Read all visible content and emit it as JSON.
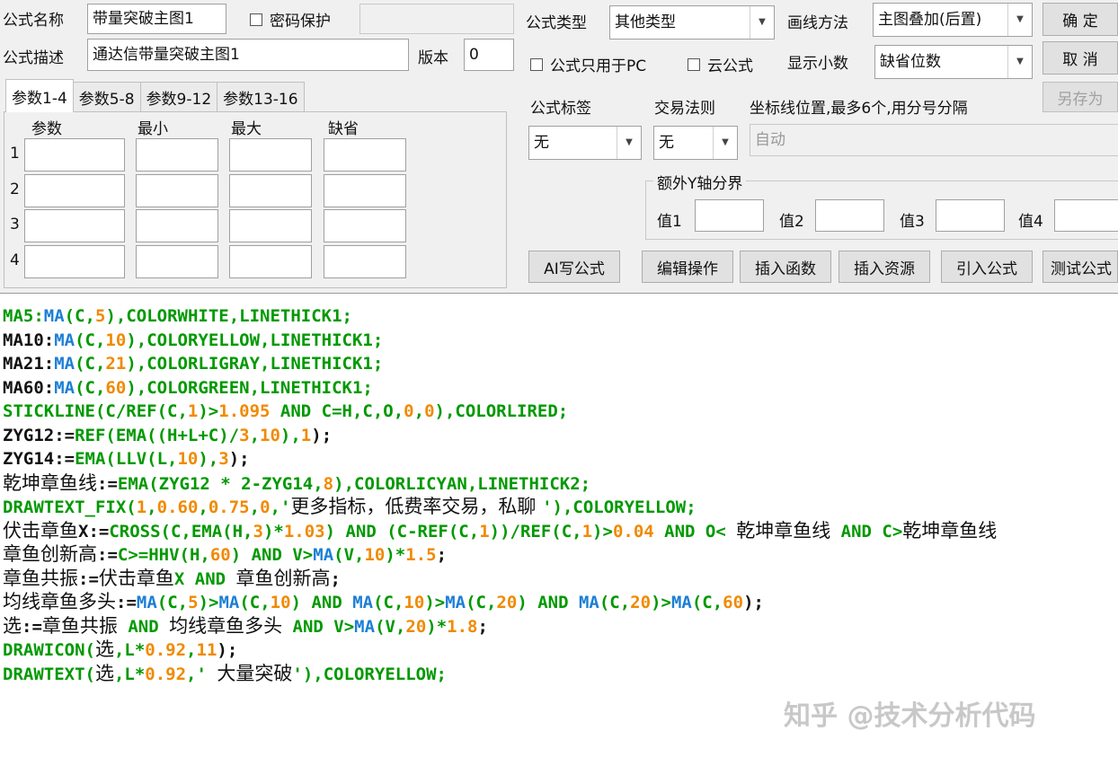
{
  "header": {
    "formula_name_label": "公式名称",
    "formula_name_value": "带量突破主图1",
    "password_label": "密码保护",
    "formula_desc_label": "公式描述",
    "formula_desc_value": "通达信带量突破主图1",
    "version_label": "版本",
    "version_value": "0",
    "formula_type_label": "公式类型",
    "formula_type_value": "其他类型",
    "draw_method_label": "画线方法",
    "draw_method_value": "主图叠加(后置)",
    "pc_only_label": "公式只用于PC",
    "cloud_label": "云公式",
    "decimals_label": "显示小数",
    "decimals_value": "缺省位数"
  },
  "buttons": {
    "ok": "确  定",
    "cancel": "取  消",
    "save_as": "另存为",
    "ai_write": "AI写公式",
    "edit_ops": "编辑操作",
    "insert_func": "插入函数",
    "insert_res": "插入资源",
    "import_formula": "引入公式",
    "test_formula": "测试公式"
  },
  "tabs": [
    "参数1-4",
    "参数5-8",
    "参数9-12",
    "参数13-16"
  ],
  "param_table": {
    "headers": [
      "参数",
      "最小",
      "最大",
      "缺省"
    ],
    "rows": [
      "1",
      "2",
      "3",
      "4"
    ]
  },
  "right_panel": {
    "tag_label": "公式标签",
    "tag_value": "无",
    "rule_label": "交易法则",
    "rule_value": "无",
    "axis_label": "坐标线位置,最多6个,用分号分隔",
    "axis_value": "自动",
    "yaxis_group": "额外Y轴分界",
    "y_labels": [
      "值1",
      "值2",
      "值3",
      "值4"
    ]
  },
  "code_lines": [
    [
      [
        "MA5:",
        "g"
      ],
      [
        "MA",
        "b"
      ],
      [
        "(C,",
        "g"
      ],
      [
        "5",
        "o"
      ],
      [
        "),COLORWHITE,LINETHICK1;",
        "g"
      ]
    ],
    [
      [
        "MA10:",
        "k"
      ],
      [
        "MA",
        "b"
      ],
      [
        "(C,",
        "g"
      ],
      [
        "10",
        "o"
      ],
      [
        "),COLORYELLOW,LINETHICK1;",
        "g"
      ]
    ],
    [
      [
        "MA21:",
        "k"
      ],
      [
        "MA",
        "b"
      ],
      [
        "(C,",
        "g"
      ],
      [
        "21",
        "o"
      ],
      [
        "),COLORLIGRAY,LINETHICK1;",
        "g"
      ]
    ],
    [
      [
        "MA60:",
        "k"
      ],
      [
        "MA",
        "b"
      ],
      [
        "(C,",
        "g"
      ],
      [
        "60",
        "o"
      ],
      [
        "),COLORGREEN,LINETHICK1;",
        "g"
      ]
    ],
    [
      [
        "STICKLINE(C/REF(C,",
        "g"
      ],
      [
        "1",
        "o"
      ],
      [
        ")>",
        "g"
      ],
      [
        "1.095",
        "o"
      ],
      [
        " AND C=H,C,O,",
        "g"
      ],
      [
        "0",
        "o"
      ],
      [
        ",",
        "g"
      ],
      [
        "0",
        "o"
      ],
      [
        "),COLORLIRED;",
        "g"
      ]
    ],
    [
      [
        "ZYG12:=",
        "k"
      ],
      [
        "REF(EMA((H+L+C)/",
        "g"
      ],
      [
        "3",
        "o"
      ],
      [
        ",",
        "g"
      ],
      [
        "10",
        "o"
      ],
      [
        "),",
        "g"
      ],
      [
        "1",
        "o"
      ],
      [
        ");",
        "k"
      ]
    ],
    [
      [
        "ZYG14:=",
        "k"
      ],
      [
        "EMA(LLV(L,",
        "g"
      ],
      [
        "10",
        "o"
      ],
      [
        "),",
        "g"
      ],
      [
        "3",
        "o"
      ],
      [
        ");",
        "k"
      ]
    ],
    [
      [
        "乾坤章鱼线",
        "kc"
      ],
      [
        ":=",
        "k"
      ],
      [
        "EMA(ZYG12 * 2-ZYG14,",
        "g"
      ],
      [
        "8",
        "o"
      ],
      [
        "),COLORLICYAN,LINETHICK2;",
        "g"
      ]
    ],
    [
      [
        "DRAWTEXT_FIX(",
        "g"
      ],
      [
        "1",
        "o"
      ],
      [
        ",",
        "g"
      ],
      [
        "0.60",
        "o"
      ],
      [
        ",",
        "g"
      ],
      [
        "0.75",
        "o"
      ],
      [
        ",",
        "g"
      ],
      [
        "0",
        "o"
      ],
      [
        ",'",
        "g"
      ],
      [
        "更多指标，低费率交易，私聊 ",
        "kc"
      ],
      [
        "'),COLORYELLOW;",
        "g"
      ]
    ],
    [
      [
        "伏击章鱼",
        "kc"
      ],
      [
        "X:=",
        "k"
      ],
      [
        "CROSS(C,EMA(H,",
        "g"
      ],
      [
        "3",
        "o"
      ],
      [
        ")*",
        "g"
      ],
      [
        "1.03",
        "o"
      ],
      [
        ") AND (C-REF(C,",
        "g"
      ],
      [
        "1",
        "o"
      ],
      [
        "))/REF(C,",
        "g"
      ],
      [
        "1",
        "o"
      ],
      [
        ")>",
        "g"
      ],
      [
        "0.04",
        "o"
      ],
      [
        " AND O< ",
        "g"
      ],
      [
        "乾坤章鱼线",
        "kc"
      ],
      [
        " AND C>",
        "g"
      ],
      [
        "乾坤章鱼线",
        "kc"
      ]
    ],
    [
      [
        "章鱼创新高",
        "kc"
      ],
      [
        ":=",
        "k"
      ],
      [
        "C>=HHV(H,",
        "g"
      ],
      [
        "60",
        "o"
      ],
      [
        ") AND V>",
        "g"
      ],
      [
        "MA",
        "b"
      ],
      [
        "(V,",
        "g"
      ],
      [
        "10",
        "o"
      ],
      [
        ")*",
        "g"
      ],
      [
        "1.5",
        "o"
      ],
      [
        ";",
        "k"
      ]
    ],
    [
      [
        "章鱼共振",
        "kc"
      ],
      [
        ":=",
        "k"
      ],
      [
        "伏击章鱼",
        "kc"
      ],
      [
        "X AND ",
        "g"
      ],
      [
        "章鱼创新高",
        "kc"
      ],
      [
        ";",
        "k"
      ]
    ],
    [
      [
        "均线章鱼多头",
        "kc"
      ],
      [
        ":=",
        "k"
      ],
      [
        "MA",
        "b"
      ],
      [
        "(C,",
        "g"
      ],
      [
        "5",
        "o"
      ],
      [
        ")>",
        "g"
      ],
      [
        "MA",
        "b"
      ],
      [
        "(C,",
        "g"
      ],
      [
        "10",
        "o"
      ],
      [
        ") AND ",
        "g"
      ],
      [
        "MA",
        "b"
      ],
      [
        "(C,",
        "g"
      ],
      [
        "10",
        "o"
      ],
      [
        ")>",
        "g"
      ],
      [
        "MA",
        "b"
      ],
      [
        "(C,",
        "g"
      ],
      [
        "20",
        "o"
      ],
      [
        ") AND ",
        "g"
      ],
      [
        "MA",
        "b"
      ],
      [
        "(C,",
        "g"
      ],
      [
        "20",
        "o"
      ],
      [
        ")>",
        "g"
      ],
      [
        "MA",
        "b"
      ],
      [
        "(C,",
        "g"
      ],
      [
        "60",
        "o"
      ],
      [
        ");",
        "k"
      ]
    ],
    [
      [
        "选",
        "kc"
      ],
      [
        ":=",
        "k"
      ],
      [
        "章鱼共振",
        "kc"
      ],
      [
        " AND ",
        "g"
      ],
      [
        "均线章鱼多头",
        "kc"
      ],
      [
        " AND V>",
        "g"
      ],
      [
        "MA",
        "b"
      ],
      [
        "(V,",
        "g"
      ],
      [
        "20",
        "o"
      ],
      [
        ")*",
        "g"
      ],
      [
        "1.8",
        "o"
      ],
      [
        ";",
        "k"
      ]
    ],
    [
      [
        "DRAWICON(",
        "g"
      ],
      [
        "选",
        "kc"
      ],
      [
        ",L*",
        "g"
      ],
      [
        "0.92",
        "o"
      ],
      [
        ",",
        "g"
      ],
      [
        "11",
        "o"
      ],
      [
        ");",
        "k"
      ]
    ],
    [
      [
        "DRAWTEXT(",
        "g"
      ],
      [
        "选",
        "kc"
      ],
      [
        ",L*",
        "g"
      ],
      [
        "0.92",
        "o"
      ],
      [
        ",' ",
        "g"
      ],
      [
        "大量突破",
        "kc"
      ],
      [
        "'),COLORYELLOW;",
        "g"
      ]
    ]
  ],
  "code_colors": {
    "g": "#009900",
    "b": "#1c7fd6",
    "o": "#f08a00",
    "k": "#111111",
    "kc": "#111111"
  },
  "watermark": "知乎 @技术分析代码"
}
